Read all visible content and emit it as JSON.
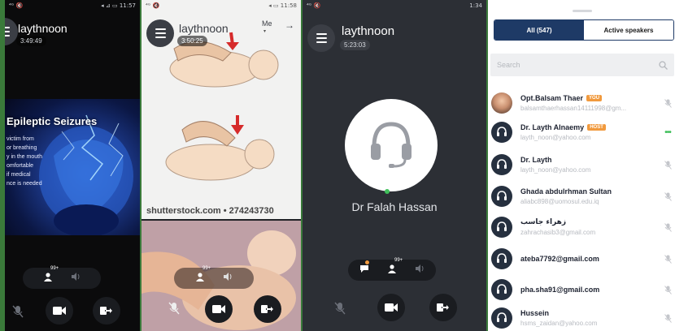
{
  "panel1": {
    "name": "laythnoon",
    "timer": "3:49:49",
    "status_left": "⁴ᴳ 🔇",
    "status_right": "◂ ⊿ ▭ 11:57",
    "slide_title": "Epileptic Seizures",
    "slide_lines": [
      "victim from",
      "or breathing",
      "y in the mouth",
      "omfortable",
      "if medical",
      "nce is needed"
    ],
    "participant_count": "99+"
  },
  "panel2": {
    "name": "laythnoon",
    "timer": "3:50:25",
    "me_label": "Me",
    "me_sub": "▾",
    "watermark": "shutterstock.com • 274243730",
    "participant_count": "99+"
  },
  "panel3": {
    "name": "laythnoon",
    "timer": "5:23:03",
    "status_right": "1:34",
    "speaker": "Dr Falah Hassan",
    "participant_count": "99+"
  },
  "panel4": {
    "tab_all": "All (547)",
    "tab_active": "Active speakers",
    "search_placeholder": "Search",
    "participants": [
      {
        "name": "Opt.Balsam Thaer",
        "email": "balsamthaerhassan14111998@gm...",
        "badge": "YOU"
      },
      {
        "name": "Dr. Layth Alnaemy",
        "email": "layth_noon@yahoo.com",
        "badge": "HOST"
      },
      {
        "name": "Dr. Layth",
        "email": "layth_noon@yahoo.com",
        "badge": ""
      },
      {
        "name": "Ghada abdulrhman Sultan",
        "email": "aliabc898@uomosul.edu.iq",
        "badge": ""
      },
      {
        "name": "زهراء جاسب",
        "email": "zahrachasib3@gmail.com",
        "badge": ""
      },
      {
        "name": "ateba7792@gmail.com",
        "email": "",
        "badge": ""
      },
      {
        "name": "pha.sha91@gmail.com",
        "email": "",
        "badge": ""
      },
      {
        "name": "Hussein",
        "email": "hsms_zaidan@yahoo.com",
        "badge": ""
      }
    ]
  },
  "colors": {
    "accent": "#1e3a66",
    "badge": "#f19a3e",
    "active_green": "#3fbf5a"
  },
  "icons": [
    "menu-icon",
    "mic-muted-icon",
    "video-icon",
    "leave-icon",
    "people-icon",
    "speaker-icon",
    "headset-icon",
    "search-icon",
    "chat-icon",
    "arrow-right-icon"
  ]
}
